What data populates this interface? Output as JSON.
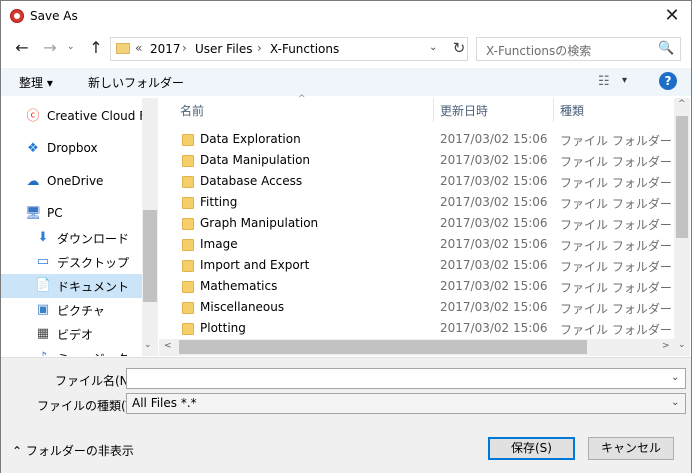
{
  "window": {
    "title": "Save As",
    "close_label": "✕"
  },
  "nav": {
    "back": "←",
    "forward": "→",
    "recent": "⌄",
    "up": "↑"
  },
  "address": {
    "overflow": "«",
    "crumbs": [
      "2017",
      "User Files",
      "X-Functions"
    ],
    "separator": "›",
    "dropdown": "⌄",
    "refresh": "↻"
  },
  "search": {
    "placeholder": "X-Functionsの検索",
    "icon": "🔍"
  },
  "toolbar": {
    "organize": "整理 ▾",
    "new_folder": "新しいフォルダー",
    "view_icon": "☷",
    "view_dd": "▾",
    "help": "?"
  },
  "nav_pane": {
    "items": [
      {
        "label": "Creative Cloud Files",
        "icon": "creative-cloud-icon",
        "glyph": "ⓒ",
        "color": "#e8431f"
      },
      {
        "label": "Dropbox",
        "icon": "dropbox-icon",
        "glyph": "❖",
        "color": "#1f7ad9"
      },
      {
        "label": "OneDrive",
        "icon": "onedrive-icon",
        "glyph": "☁",
        "color": "#1f6fc5"
      },
      {
        "label": "PC",
        "icon": "pc-icon",
        "glyph": "🖥",
        "color": "#3a76c8"
      },
      {
        "label": "ダウンロード",
        "icon": "download-icon",
        "glyph": "⬇",
        "color": "#2d7fd8"
      },
      {
        "label": "デスクトップ",
        "icon": "desktop-icon",
        "glyph": "▭",
        "color": "#2d7fd8"
      },
      {
        "label": "ドキュメント",
        "icon": "documents-icon",
        "glyph": "📄",
        "color": "#555555"
      },
      {
        "label": "ピクチャ",
        "icon": "pictures-icon",
        "glyph": "▣",
        "color": "#3c80c6"
      },
      {
        "label": "ビデオ",
        "icon": "videos-icon",
        "glyph": "▦",
        "color": "#444444"
      },
      {
        "label": "ミュージック",
        "icon": "music-icon",
        "glyph": "♪",
        "color": "#2d7fd8"
      }
    ],
    "selected": "ドキュメント"
  },
  "columns": {
    "name": "名前",
    "date": "更新日時",
    "type": "種類"
  },
  "files": [
    {
      "name": "Data Exploration",
      "date": "2017/03/02 15:06",
      "type": "ファイル フォルダー"
    },
    {
      "name": "Data Manipulation",
      "date": "2017/03/02 15:06",
      "type": "ファイル フォルダー"
    },
    {
      "name": "Database Access",
      "date": "2017/03/02 15:06",
      "type": "ファイル フォルダー"
    },
    {
      "name": "Fitting",
      "date": "2017/03/02 15:06",
      "type": "ファイル フォルダー"
    },
    {
      "name": "Graph Manipulation",
      "date": "2017/03/02 15:06",
      "type": "ファイル フォルダー"
    },
    {
      "name": "Image",
      "date": "2017/03/02 15:06",
      "type": "ファイル フォルダー"
    },
    {
      "name": "Import and Export",
      "date": "2017/03/02 15:06",
      "type": "ファイル フォルダー"
    },
    {
      "name": "Mathematics",
      "date": "2017/03/02 15:06",
      "type": "ファイル フォルダー"
    },
    {
      "name": "Miscellaneous",
      "date": "2017/03/02 15:06",
      "type": "ファイル フォルダー"
    },
    {
      "name": "Plotting",
      "date": "2017/03/02 15:06",
      "type": "ファイル フォルダー"
    }
  ],
  "filename": {
    "label": "ファイル名(N):",
    "value": ""
  },
  "filetype": {
    "label": "ファイルの種類(T):",
    "value": "All Files *.*"
  },
  "footer": {
    "hide_folders": "フォルダーの非表示",
    "save": "保存(S)",
    "cancel": "キャンセル"
  },
  "colors": {
    "accent": "#0078d7",
    "selected_bg": "#cce4f7",
    "folder": "#f5cf6a"
  }
}
